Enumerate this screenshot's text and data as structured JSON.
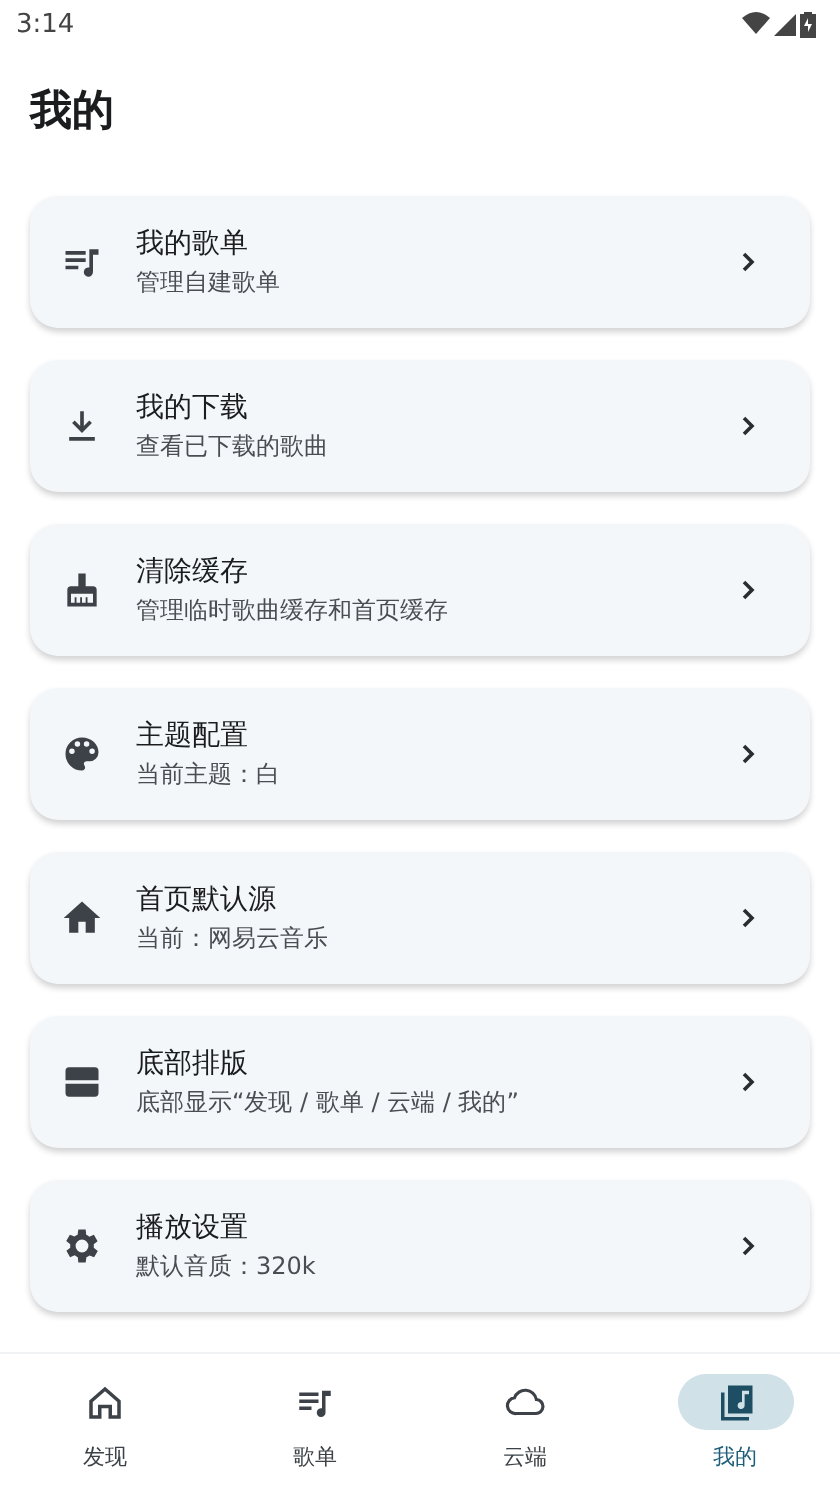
{
  "status_bar": {
    "time": "3:14"
  },
  "title": "我的",
  "items": [
    {
      "kind": "playlist",
      "title": "我的歌单",
      "subtitle": "管理自建歌单"
    },
    {
      "kind": "download",
      "title": "我的下载",
      "subtitle": "查看已下载的歌曲"
    },
    {
      "kind": "broom",
      "title": "清除缓存",
      "subtitle": "管理临时歌曲缓存和首页缓存"
    },
    {
      "kind": "palette",
      "title": "主题配置",
      "subtitle": "当前主题：白"
    },
    {
      "kind": "home",
      "title": "首页默认源",
      "subtitle": "当前：网易云音乐"
    },
    {
      "kind": "layout",
      "title": "底部排版",
      "subtitle": "底部显示“发现 / 歌单 / 云端 / 我的”"
    },
    {
      "kind": "settings",
      "title": "播放设置",
      "subtitle": "默认音质：320k"
    }
  ],
  "nav": [
    {
      "kind": "home",
      "label": "发现",
      "selected": false
    },
    {
      "kind": "playlist",
      "label": "歌单",
      "selected": false
    },
    {
      "kind": "cloud",
      "label": "云端",
      "selected": false
    },
    {
      "kind": "library",
      "label": "我的",
      "selected": true
    }
  ]
}
